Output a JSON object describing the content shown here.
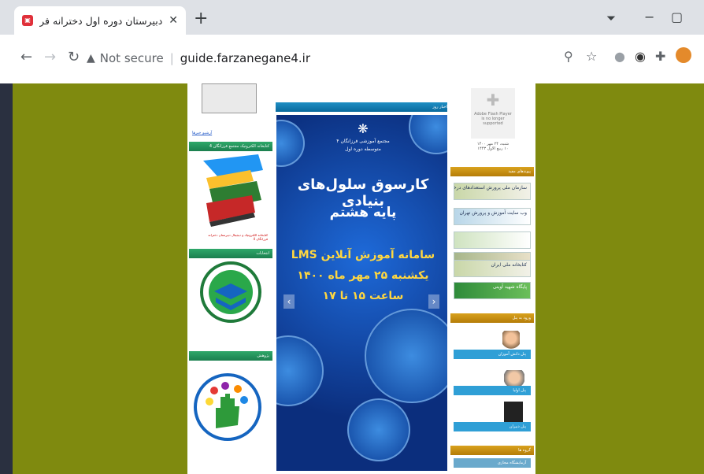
{
  "browser": {
    "tab_title": "دبیرستان دوره اول دخترانه فرزانگان4",
    "tab_close": "✕",
    "new_tab": "+",
    "security_label": "Not secure",
    "url": "guide.farzanegane4.ir",
    "window_controls": {
      "minimize": "−",
      "maximize": "▢"
    },
    "icons": {
      "security": "warning-triangle",
      "zoom": "zoom-icon",
      "star": "bookmark-star",
      "puzzle": "extensions"
    }
  },
  "page": {
    "left": {
      "archive_link": "آرشیو خبرها",
      "library_header": "کتابخانه الکترونیک مجتمع فرزانگان 4",
      "library_caption": "کتابخانه الکترونیک و دیجیتال دبیرستان دخترانه فرزانگان 4",
      "elections_header": "انتخابات",
      "research_header": "پژوهش"
    },
    "middle": {
      "news_header": "اخبار روز",
      "banner": {
        "school": "مجتمع آموزشی فرزانگان ۴",
        "school_sub": "متوسطه دوره اول",
        "title1": "کارسوق سلول‌های بنیادی",
        "title2": "پایه هشتم",
        "lms": "سامانه آموزش آنلاین LMS",
        "date": "یکشنبه ۲۵ مهر ماه ۱۴۰۰",
        "time": "ساعت ۱۵ تا ۱۷"
      }
    },
    "right": {
      "flash_text": "Adobe Flash Player is no longer supported",
      "date_line1": "شنبه، ۲۴ مهر ۱۴۰۰",
      "date_line2": "۱۰ ربیع الاول ۱۴۴۳",
      "links_header": "پیوندهای مفید",
      "links": [
        "سازمان ملی پرورش استعدادهای درخشان",
        "وب سایت آموزش و پرورش تهران",
        "",
        "",
        "کتابخانه ملی ایران",
        "پایگاه شهید آوینی"
      ],
      "login_header": "ورود به پنل",
      "panels": [
        "پنل دانش آموزان",
        "پنل اولیا",
        "پنل دبیران"
      ],
      "groups_header": "گروه ها",
      "groups_item": "آزمایشگاه مجازی"
    }
  }
}
